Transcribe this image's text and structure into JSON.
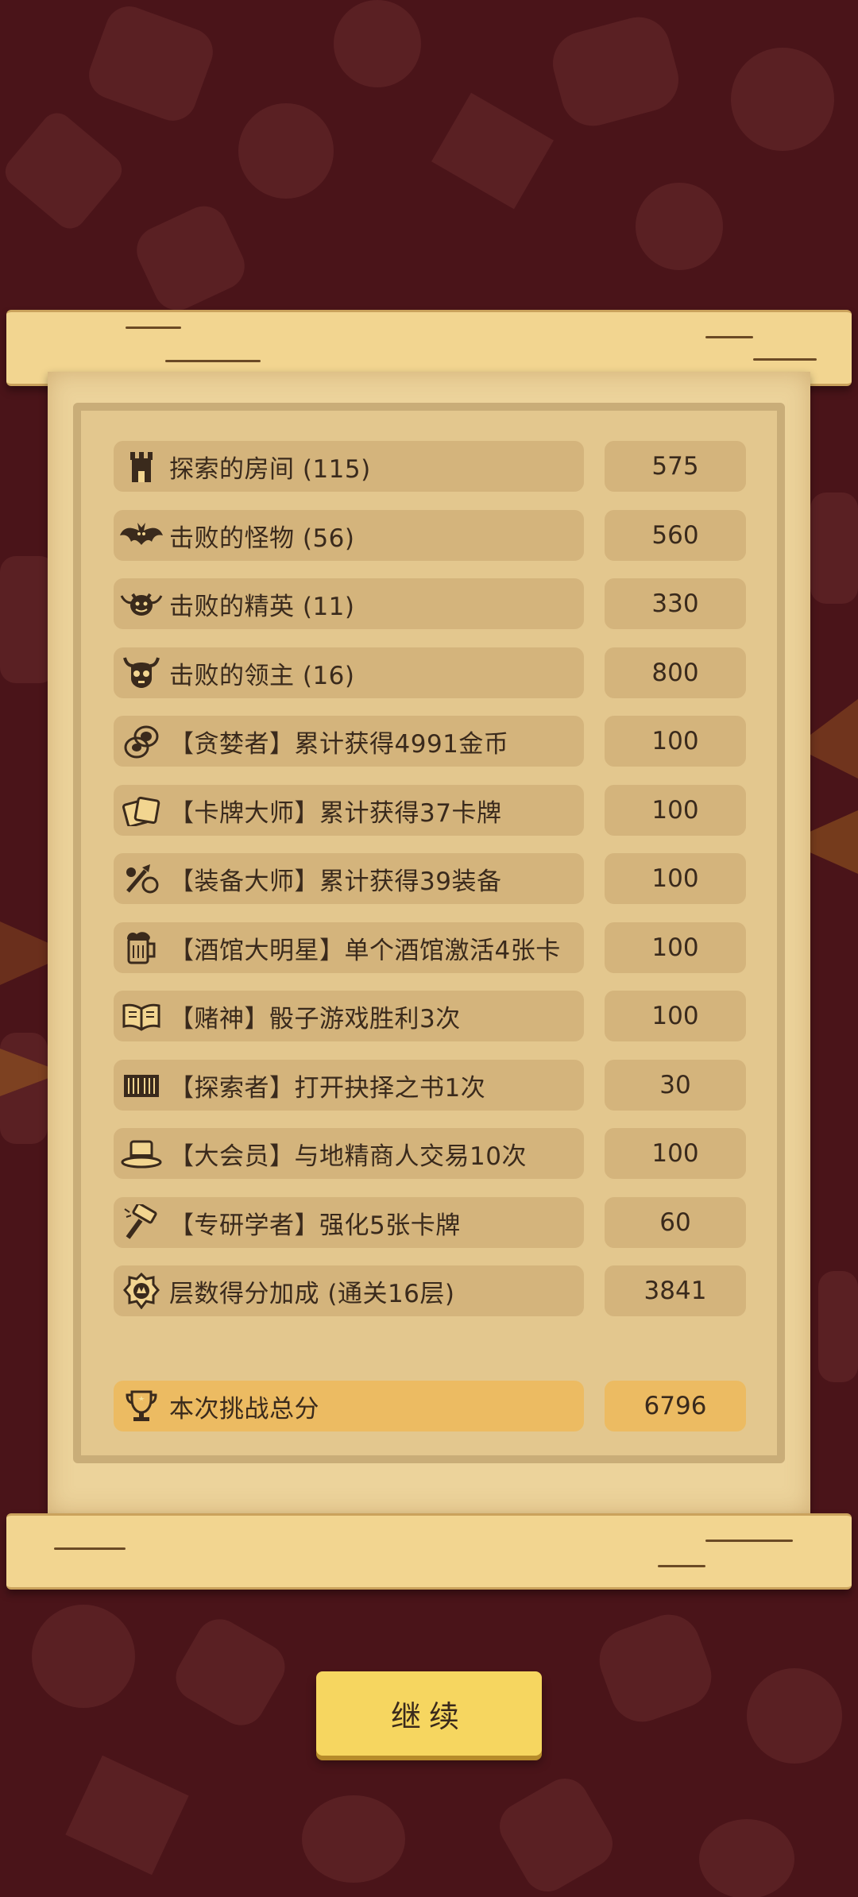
{
  "rows": [
    {
      "label": "探索的房间 (115)",
      "value": "575",
      "icon": "tower-icon"
    },
    {
      "label": "击败的怪物 (56)",
      "value": "560",
      "icon": "bat-icon"
    },
    {
      "label": "击败的精英 (11)",
      "value": "330",
      "icon": "demon-icon"
    },
    {
      "label": "击败的领主 (16)",
      "value": "800",
      "icon": "boss-skull-icon"
    },
    {
      "label": "【贪婪者】累计获得4991金币",
      "value": "100",
      "icon": "coins-icon"
    },
    {
      "label": "【卡牌大师】累计获得37卡牌",
      "value": "100",
      "icon": "cards-icon"
    },
    {
      "label": "【装备大师】累计获得39装备",
      "value": "100",
      "icon": "equipment-icon"
    },
    {
      "label": "【酒馆大明星】单个酒馆激活4张卡",
      "value": "100",
      "icon": "beer-mug-icon"
    },
    {
      "label": "【赌神】骰子游戏胜利3次",
      "value": "100",
      "icon": "open-book-icon"
    },
    {
      "label": "【探索者】打开抉择之书1次",
      "value": "30",
      "icon": "book-icon"
    },
    {
      "label": "【大会员】与地精商人交易10次",
      "value": "100",
      "icon": "top-hat-icon"
    },
    {
      "label": "【专研学者】强化5张卡牌",
      "value": "60",
      "icon": "hammer-icon"
    },
    {
      "label": "层数得分加成 (通关16层)",
      "value": "3841",
      "icon": "floor-badge-icon"
    }
  ],
  "total": {
    "label": "本次挑战总分",
    "value": "6796",
    "icon": "trophy-icon"
  },
  "continue_button": "继续",
  "colors": {
    "background": "#4a1419",
    "paper": "#ecd39b",
    "row_bg": "#d4b47c",
    "total_bg": "#ecbb62",
    "button": "#f6d660",
    "text": "#3a2a1c"
  }
}
